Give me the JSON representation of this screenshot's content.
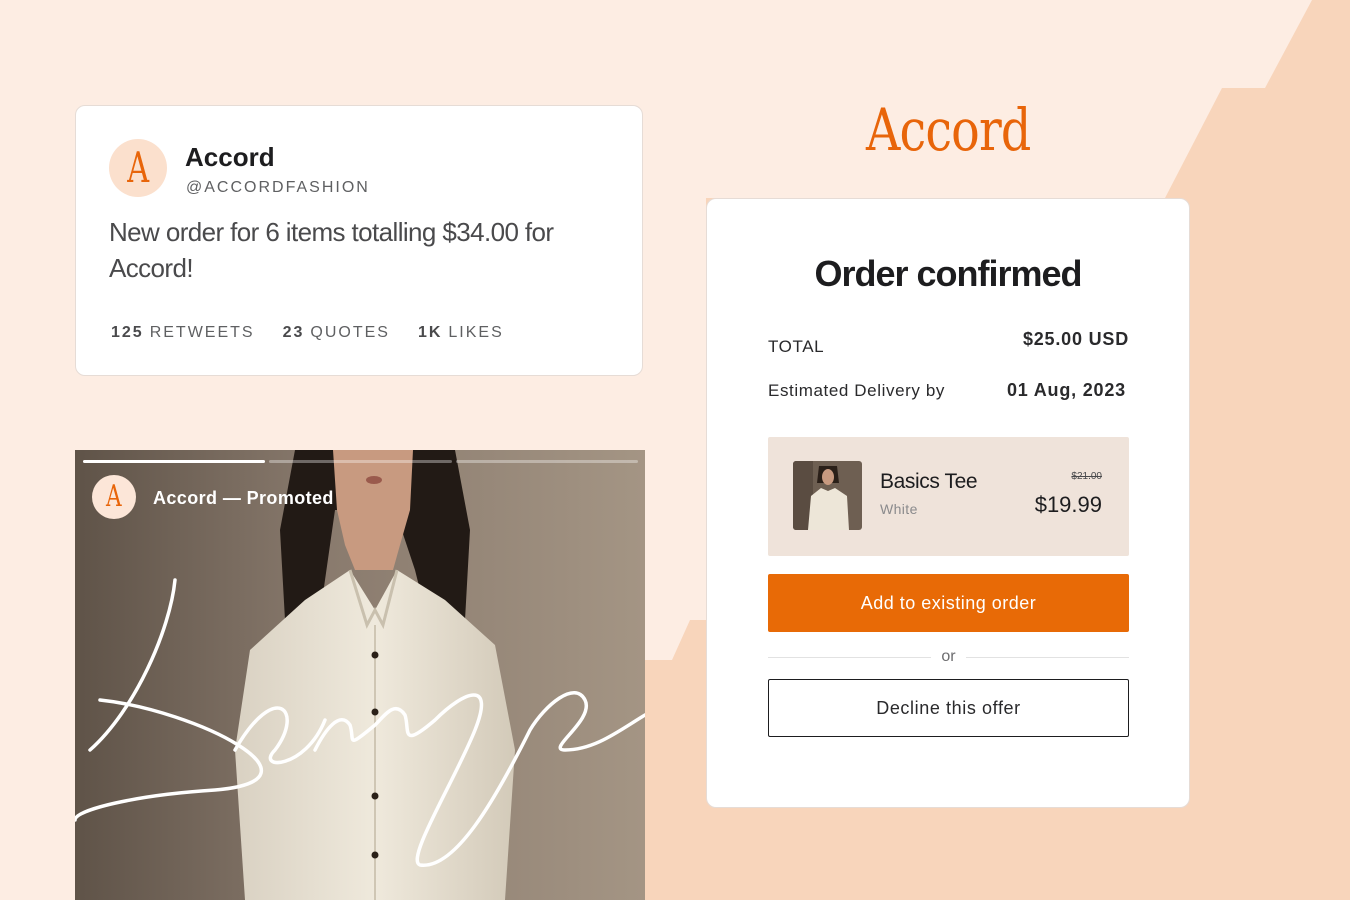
{
  "tweet": {
    "avatar_letter": "A",
    "name": "Accord",
    "handle": "@ACCORDFASHION",
    "body": "New order for 6 items totalling $34.00 for Accord!",
    "stats": [
      {
        "count": "125",
        "label": "RETWEETS"
      },
      {
        "count": "23",
        "label": "QUOTES"
      },
      {
        "count": "1K",
        "label": "LIKES"
      }
    ]
  },
  "story": {
    "avatar_letter": "A",
    "title": "Accord — Promoted",
    "progress": [
      1,
      0,
      0
    ],
    "overlay_script": "Lounge"
  },
  "logo": "Accord",
  "order": {
    "heading": "Order confirmed",
    "total_label": "TOTAL",
    "total_value": "$25.00 USD",
    "delivery_label": "Estimated Delivery by",
    "delivery_value": "01 Aug, 2023",
    "item": {
      "name": "Basics Tee",
      "variant": "White",
      "original_price": "$21.00",
      "price": "$19.99"
    },
    "add_button": "Add to existing order",
    "or_text": "or",
    "decline_button": "Decline this offer"
  },
  "colors": {
    "accent": "#e86a06",
    "background": "#fdede3",
    "background_shape": "#f8d5bb"
  }
}
